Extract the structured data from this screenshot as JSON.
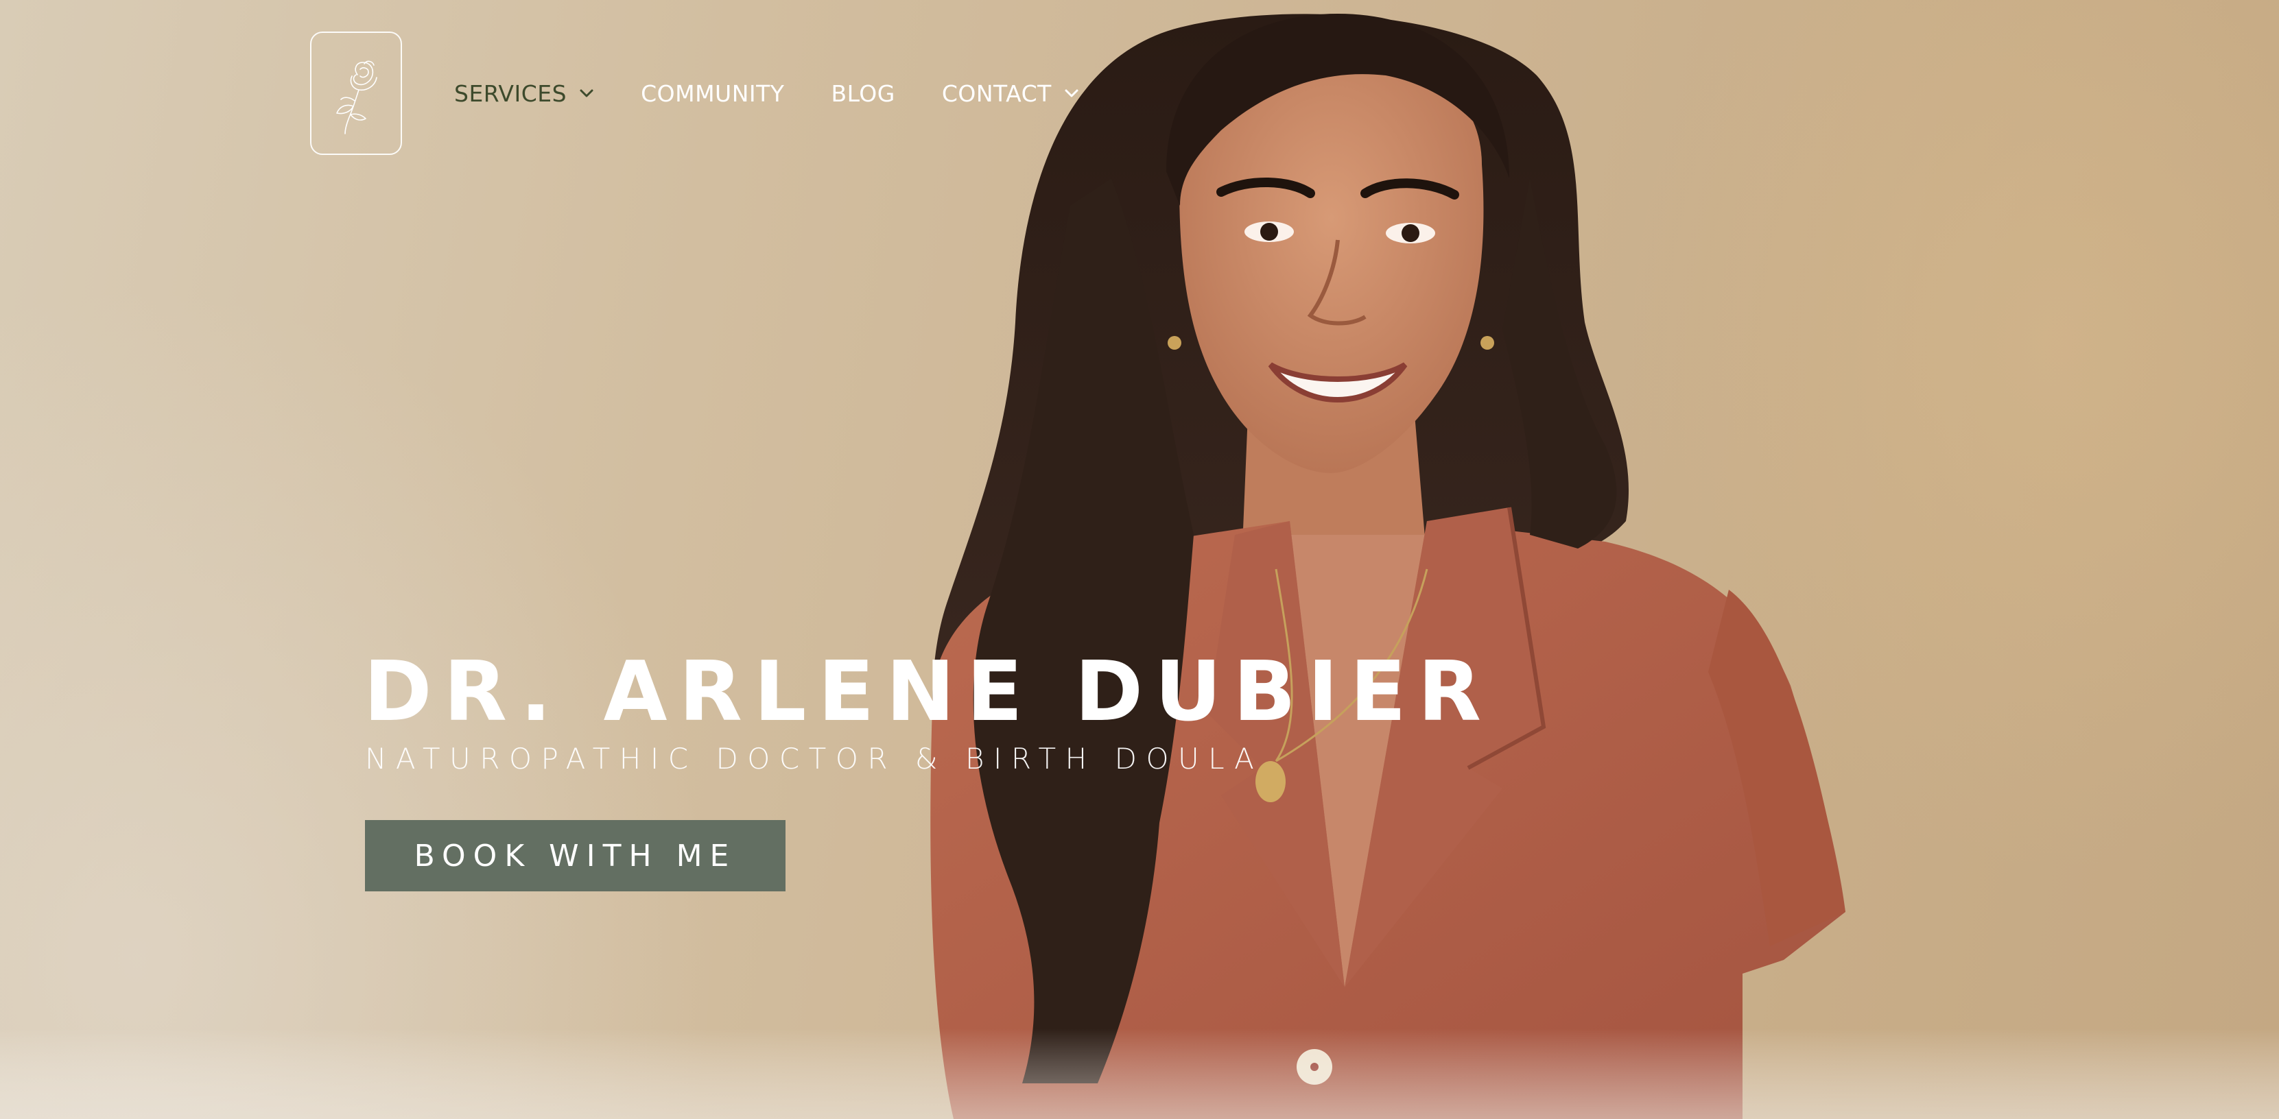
{
  "header": {
    "logo_icon": "rose-icon",
    "nav": [
      {
        "label": "SERVICES",
        "has_dropdown": true,
        "active": true
      },
      {
        "label": "COMMUNITY",
        "has_dropdown": false
      },
      {
        "label": "BLOG",
        "has_dropdown": false
      },
      {
        "label": "CONTACT",
        "has_dropdown": true
      }
    ]
  },
  "hero": {
    "title": "DR. ARLENE DUBIER",
    "subtitle": "NATUROPATHIC DOCTOR & BIRTH DOULA",
    "cta_label": "BOOK WITH ME"
  },
  "colors": {
    "nav_active": "#3d4a2c",
    "nav_default": "#ffffff",
    "cta_background": "#636f62",
    "background": "#d2bea0",
    "shirt": "#b25f46",
    "hair": "#2b1d16",
    "skin": "#c88a67"
  }
}
